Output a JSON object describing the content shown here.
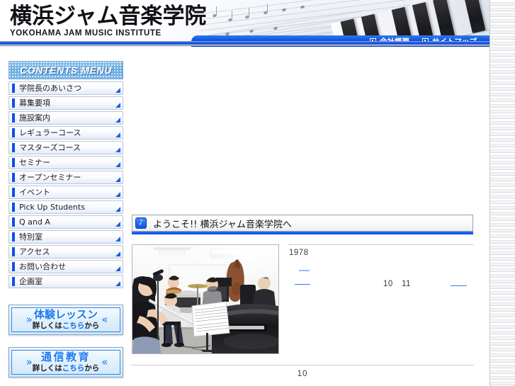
{
  "site": {
    "logo_jp": "横浜ジャム音楽学院",
    "logo_en": "YOKOHAMA JAM MUSIC INSTITUTE"
  },
  "header_nav": {
    "items": [
      {
        "label": "会社概要",
        "icon": "square-bullet-icon"
      },
      {
        "label": "サイトマップ",
        "icon": "square-bullet-icon"
      }
    ]
  },
  "sidebar": {
    "menu_title": "CONTENTS MENU",
    "items": [
      {
        "label": "学院長のあいさつ"
      },
      {
        "label": "募集要項"
      },
      {
        "label": "施設案内"
      },
      {
        "label": "レギュラーコース"
      },
      {
        "label": "マスターズコース"
      },
      {
        "label": "セミナー"
      },
      {
        "label": "オープンセミナー"
      },
      {
        "label": "イベント"
      },
      {
        "label": "Pick Up Students"
      },
      {
        "label": "Q and A"
      },
      {
        "label": "特別室"
      },
      {
        "label": "アクセス"
      },
      {
        "label": "お問い合わせ"
      },
      {
        "label": "企画室"
      }
    ],
    "banners": [
      {
        "title": "体験レッスン",
        "sub_before": "詳しくは",
        "sub_highlight": "こちら",
        "sub_after": "から",
        "chevron_left": "»",
        "chevron_right": "«",
        "spaced": false
      },
      {
        "title": "通信教育",
        "sub_before": "詳しくは",
        "sub_highlight": "こちら",
        "sub_after": "から",
        "chevron_left": "»",
        "chevron_right": "«",
        "spaced": true
      }
    ]
  },
  "main": {
    "section_heading": "ようこそ!! 横浜ジャム音楽学院へ",
    "section_heading_icon": "music-note-icon",
    "photo_alt": "music-ensemble-rehearsal-photo",
    "article": {
      "year": "1978",
      "inline_numbers": [
        "10",
        "11"
      ]
    },
    "footer_number": "10"
  },
  "colors": {
    "accent_blue": "#0a55ef",
    "nav_blue": "#0b4fe0",
    "menu_header_blue": "#5fa8e0",
    "link_blue": "#2f7de8",
    "visited_link_blue": "#8fbcf2",
    "banner_text_blue": "#1a7bf0"
  }
}
